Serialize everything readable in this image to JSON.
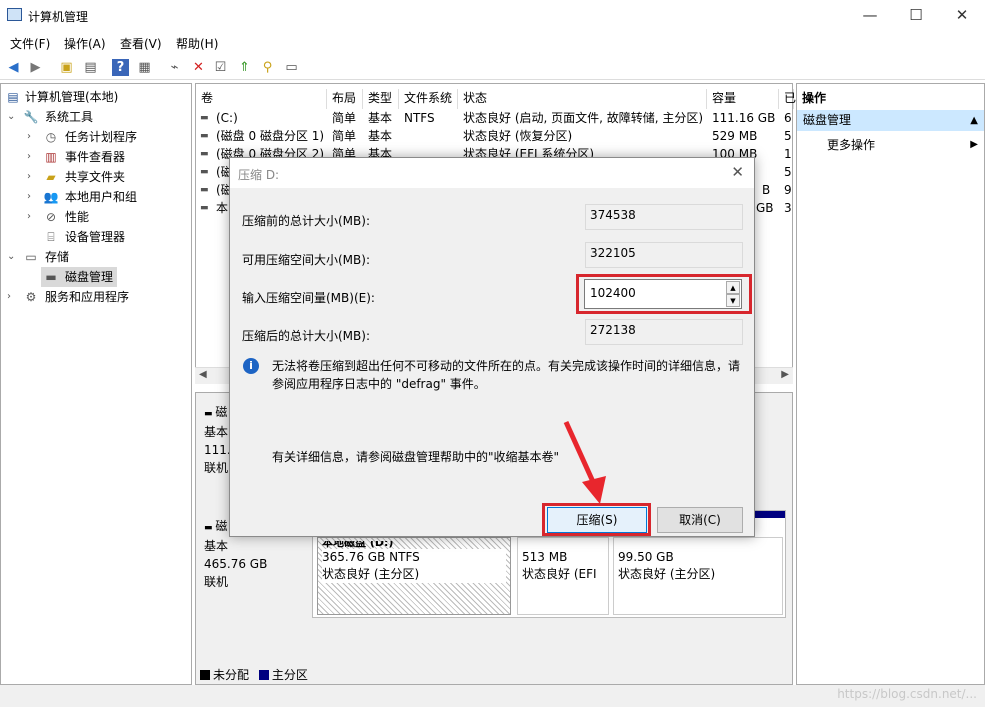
{
  "window": {
    "title": "计算机管理",
    "minimize_icon": "—",
    "maximize_icon": "☐",
    "close_icon": "✕"
  },
  "menu": [
    "文件(F)",
    "操作(A)",
    "查看(V)",
    "帮助(H)"
  ],
  "tree": {
    "root": "计算机管理(本地)",
    "items": [
      {
        "label": "系统工具"
      },
      {
        "label": "任务计划程序"
      },
      {
        "label": "事件查看器"
      },
      {
        "label": "共享文件夹"
      },
      {
        "label": "本地用户和组"
      },
      {
        "label": "性能"
      },
      {
        "label": "设备管理器"
      },
      {
        "label": "存储"
      },
      {
        "label": "磁盘管理"
      },
      {
        "label": "服务和应用程序"
      }
    ]
  },
  "volume_list": {
    "headers": [
      "卷",
      "布局",
      "类型",
      "文件系统",
      "状态",
      "容量",
      "已"
    ],
    "rows": [
      {
        "vol": "(C:)",
        "layout": "简单",
        "type": "基本",
        "fs": "NTFS",
        "status": "状态良好 (启动, 页面文件, 故障转储, 主分区)",
        "cap": "111.16 GB",
        "free": "6"
      },
      {
        "vol": "(磁盘 0 磁盘分区 1)",
        "layout": "简单",
        "type": "基本",
        "fs": "",
        "status": "状态良好 (恢复分区)",
        "cap": "529 MB",
        "free": "5"
      },
      {
        "vol": "(磁盘 0 磁盘分区 2)",
        "layout": "简单",
        "type": "基本",
        "fs": "",
        "status": "状态良好 (EFI 系统分区)",
        "cap": "100 MB",
        "free": "1"
      },
      {
        "vol": "(磁",
        "layout": "",
        "type": "",
        "fs": "",
        "status": "",
        "cap": "",
        "free": "5"
      },
      {
        "vol": "(磁",
        "layout": "",
        "type": "",
        "fs": "",
        "status": "",
        "cap": "B",
        "free": "9"
      },
      {
        "vol": "本",
        "layout": "",
        "type": "",
        "fs": "",
        "status": "",
        "cap": "GB",
        "free": "3"
      }
    ]
  },
  "graphical": {
    "disk0": {
      "name": "磁",
      "type": "基本",
      "size": "111.",
      "state": "联机"
    },
    "disk1": {
      "name": "磁",
      "type": "基本",
      "size": "465.76 GB",
      "state": "联机"
    },
    "parts": [
      {
        "size": "365.76 GB NTFS",
        "status": "状态良好 (主分区)"
      },
      {
        "size": "513 MB",
        "status": "状态良好 (EFI"
      },
      {
        "size": "99.50 GB",
        "status": "状态良好 (主分区)"
      }
    ],
    "part0_title": "本地磁盘 (D:)",
    "legend": [
      "未分配",
      "主分区"
    ]
  },
  "actions": {
    "header": "操作",
    "section": "磁盘管理",
    "more": "更多操作"
  },
  "dialog": {
    "title": "压缩 D:",
    "fields": [
      {
        "label": "压缩前的总计大小(MB):",
        "value": "374538"
      },
      {
        "label": "可用压缩空间大小(MB):",
        "value": "322105"
      },
      {
        "label": "输入压缩空间量(MB)(E):",
        "value": "102400"
      },
      {
        "label": "压缩后的总计大小(MB):",
        "value": "272138"
      }
    ],
    "info": "无法将卷压缩到超出任何不可移动的文件所在的点。有关完成该操作时间的详细信息，请参阅应用程序日志中的 \"defrag\" 事件。",
    "help": "有关详细信息，请参阅磁盘管理帮助中的\"收缩基本卷\"",
    "shrink_button": "压缩(S)",
    "cancel_button": "取消(C)"
  },
  "watermark": "https://blog.csdn.net/...",
  "colors": {
    "highlight": "#d7262d",
    "primary_partition": "#000080",
    "unallocated": "#000000",
    "selection": "#cce8ff"
  }
}
